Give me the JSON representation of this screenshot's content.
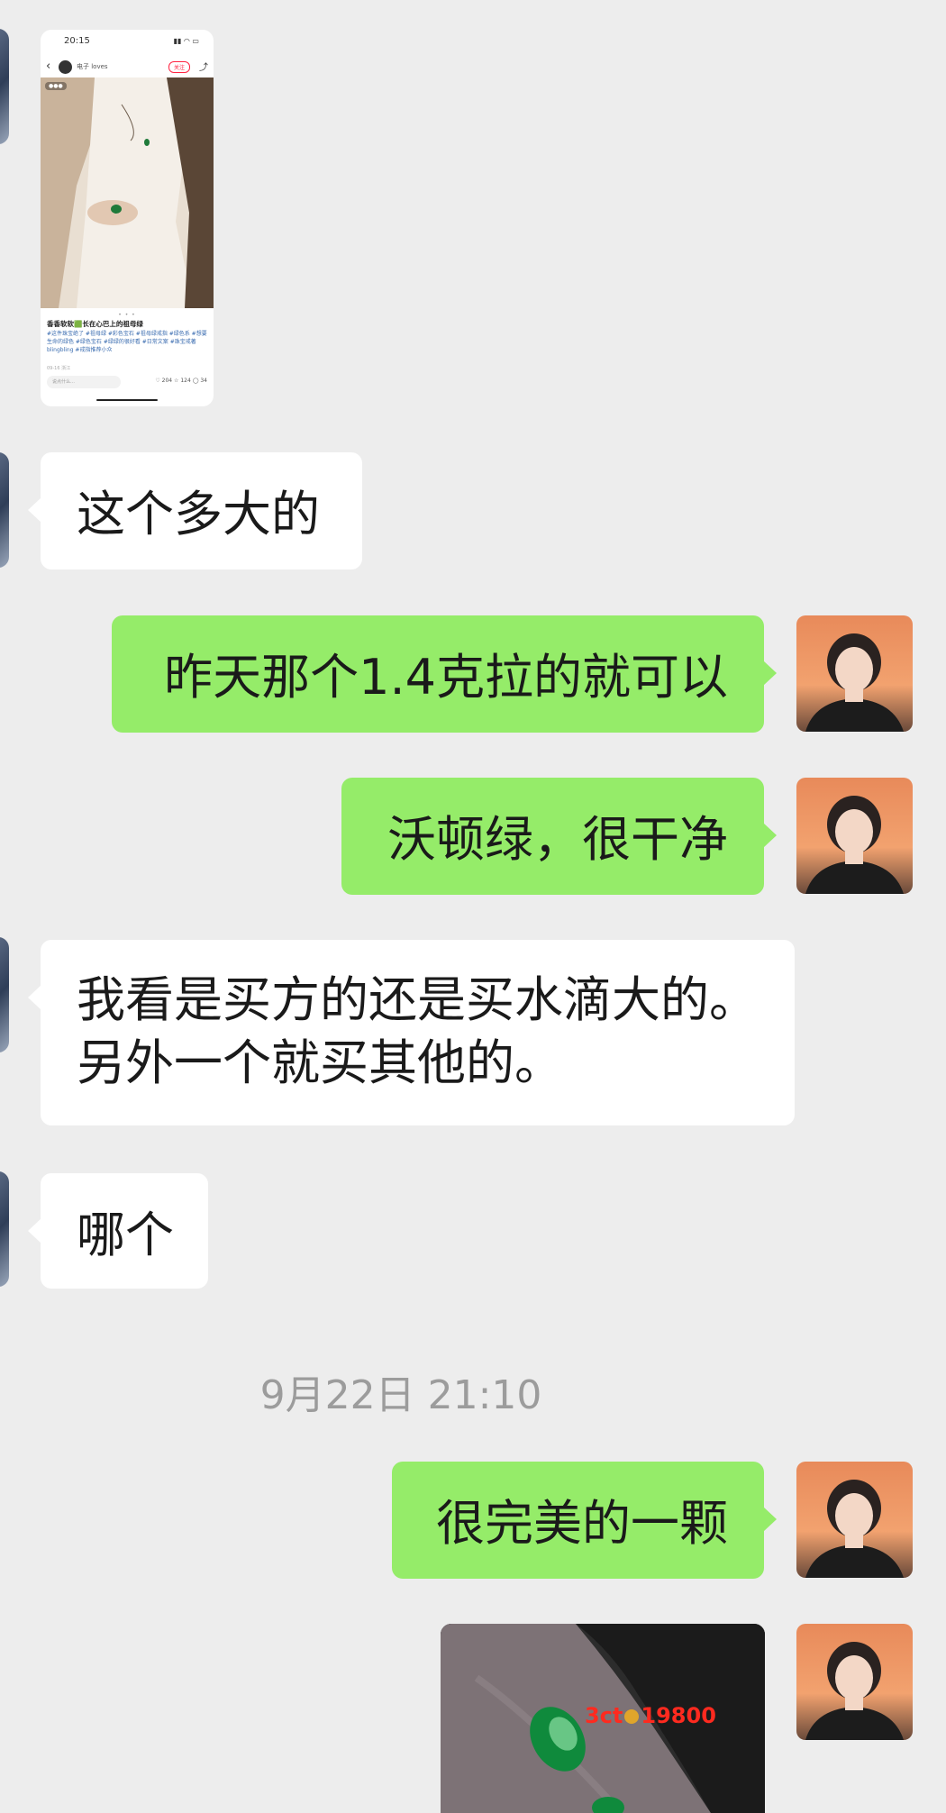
{
  "shared_post": {
    "status_time": "20:15",
    "author_name": "电子 loves",
    "follow_label": "关注",
    "title": "香香软软🟩长在心巴上的祖母绿",
    "tags": "#这件珠宝绝了 #祖母绿 #彩色宝石 #祖母绿戒指 #绿色系 #想要生命的绿色 #绿色宝石 #绿绿的很好看 #日常文案 #珠宝戒著 blingbling #戒指推荐小众",
    "date": "09-16 浙江",
    "comment_placeholder": "说点什么…",
    "likes": "204",
    "collects": "124",
    "comments": "34"
  },
  "messages": [
    {
      "side": "in",
      "text": "这个多大的"
    },
    {
      "side": "out",
      "text": "昨天那个1.4克拉的就可以"
    },
    {
      "side": "out",
      "text": "沃顿绿，很干净"
    },
    {
      "side": "in",
      "lines": [
        "我看是买方的还是买水滴大的。",
        "另外一个就买其他的。"
      ]
    },
    {
      "side": "in",
      "text": "哪个"
    },
    {
      "side": "out",
      "text": "很完美的一颗"
    }
  ],
  "timestamp": "9月22日 21:10",
  "image_message": {
    "weight": "3ct",
    "price": "19800"
  },
  "colors": {
    "background": "#ededed",
    "incoming_bubble": "#ffffff",
    "outgoing_bubble": "#95ec69",
    "price_text": "#ff2a1f"
  }
}
